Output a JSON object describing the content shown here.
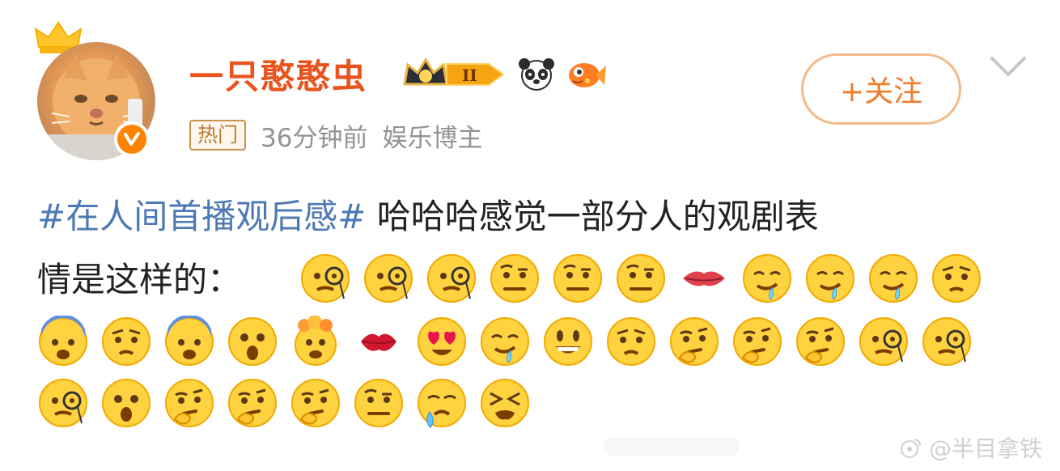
{
  "user": {
    "name": "一只憨憨虫",
    "level": "II",
    "verified": true
  },
  "meta": {
    "tag": "热门",
    "time": "36分钟前",
    "category": "娱乐博主"
  },
  "actions": {
    "follow_label": "+关注"
  },
  "post": {
    "hashtag": "#在人间首播观后感#",
    "text_line1": " 哈哈哈感觉一部分人的观剧表",
    "text_line2": "情是这样的："
  },
  "emoji_rows": [
    [
      "monocle",
      "monocle",
      "monocle",
      "raised-eyebrow",
      "raised-eyebrow",
      "raised-eyebrow",
      "mouth",
      "drooling",
      "drooling",
      "drooling",
      "worried"
    ],
    [
      "fearful",
      "worried",
      "fearful",
      "astonished",
      "exploding-head",
      "kiss-mark",
      "heart-eyes",
      "drooling",
      "grinning",
      "worried",
      "thinking",
      "thinking",
      "thinking",
      "monocle",
      "monocle"
    ],
    [
      "monocle",
      "astonished",
      "thinking",
      "thinking",
      "thinking",
      "raised-eyebrow",
      "sweat",
      "tired"
    ]
  ],
  "watermark": "@半目拿铁",
  "colors": {
    "username": "#e8531e",
    "hashtag": "#4d79b4",
    "follow": "#f07b2b",
    "meta": "#939393"
  }
}
